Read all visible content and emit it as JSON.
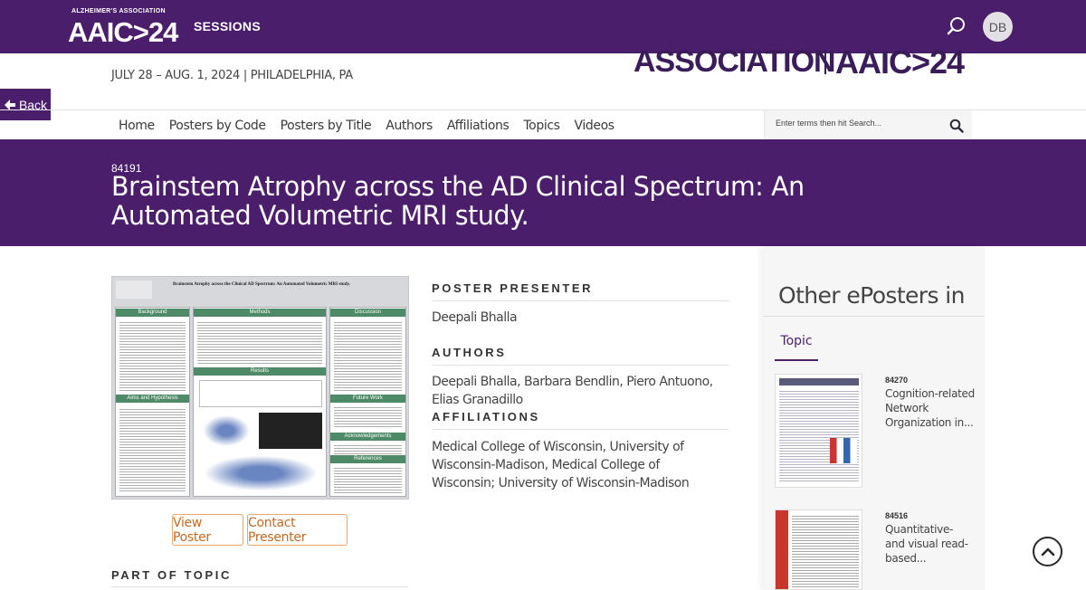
{
  "topbar": {
    "logo_small": "ALZHEIMER'S ASSOCIATION",
    "logo_big": "AAIC>24",
    "sessions_label": "SESSIONS",
    "avatar_initials": "DB",
    "bg_color": "#4b1e6b"
  },
  "header": {
    "dateline": "JULY 28 – AUG. 1, 2024 | PHILADELPHIA, PA",
    "assoc_text": "ASSOCIATION",
    "assoc_aaic": "AAIC>24",
    "back_label": "Back"
  },
  "nav": {
    "items": [
      "Home",
      "Posters by Code",
      "Posters by Title",
      "Authors",
      "Affiliations",
      "Topics",
      "Videos"
    ],
    "search_placeholder": "Enter terms then hit Search..."
  },
  "poster": {
    "code": "84191",
    "title": "Brainstem Atrophy across the AD Clinical Spectrum: An Automated Volumetric MRI study.",
    "thumb_title": "Brainstem Atrophy across the Clinical AD Spectrum: An Automated Volumetric MRI study.",
    "thumb_sections": [
      "Background",
      "Methods",
      "Discussion",
      "Results",
      "Aims and Hypothesis",
      "Future Work",
      "Acknowledgements",
      "References"
    ],
    "view_label": "View Poster",
    "contact_label": "Contact Presenter",
    "part_of_topic_label": "PART OF TOPIC"
  },
  "info": {
    "presenter_label": "POSTER PRESENTER",
    "presenter": "Deepali Bhalla",
    "authors_label": "AUTHORS",
    "authors": "Deepali Bhalla, Barbara Bendlin, Piero Antuono, Elias Granadillo",
    "affiliations_label": "AFFILIATIONS",
    "affiliations": "Medical College of Wisconsin, University of Wisconsin-Madison, Medical College of Wisconsin; University of Wisconsin-Madison"
  },
  "sidebar": {
    "title": "Other ePosters in",
    "tab": "Topic",
    "items": [
      {
        "code": "84270",
        "title": "Cognition-related Network Organization in..."
      },
      {
        "code": "84516",
        "title": "Quantitative- and visual read-based..."
      }
    ]
  }
}
